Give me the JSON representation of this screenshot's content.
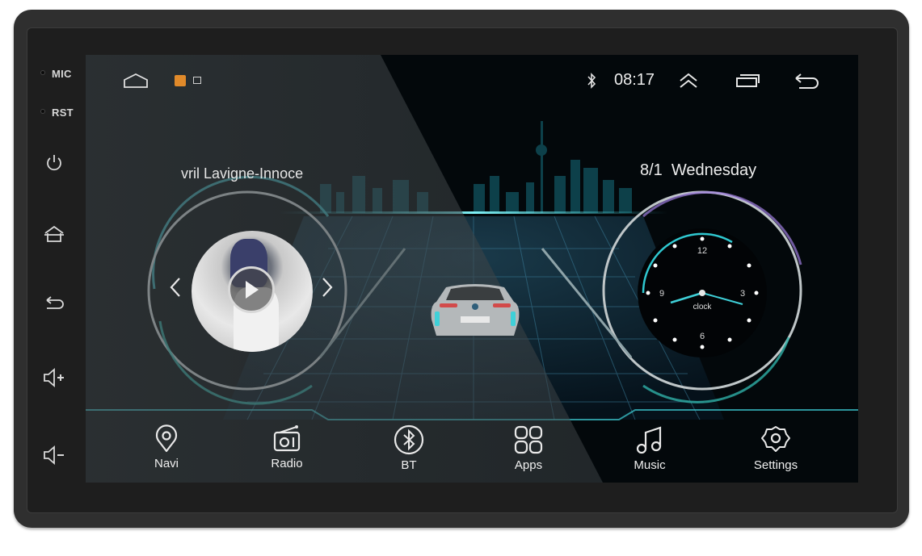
{
  "device": {
    "side_labels": {
      "mic": "MIC",
      "rst": "RST"
    },
    "side_buttons": [
      {
        "name": "power",
        "icon": "power-icon"
      },
      {
        "name": "home",
        "icon": "home-icon"
      },
      {
        "name": "back",
        "icon": "back-icon"
      },
      {
        "name": "volume-up",
        "icon": "volume-up-icon"
      },
      {
        "name": "volume-down",
        "icon": "volume-down-icon"
      }
    ]
  },
  "statusbar": {
    "left_icons": [
      "home-outline-icon",
      "notification-app-icon",
      "notification-image-icon"
    ],
    "bluetooth_icon": "bluetooth-icon",
    "time": "08:17",
    "right_icons": [
      "collapse-up-icon",
      "recent-apps-icon",
      "back-arrow-icon"
    ]
  },
  "media": {
    "song_title": "vril Lavigne-Innoce",
    "prev_icon": "chevron-left-icon",
    "next_icon": "chevron-right-icon",
    "play_icon": "play-icon"
  },
  "clock_widget": {
    "date": "8/1  Wednesday",
    "label": "clock",
    "numerals": [
      "12",
      "3",
      "6",
      "9"
    ],
    "time_shown": "08:17"
  },
  "dock": {
    "items": [
      {
        "label": "Navi",
        "icon": "location-pin-icon"
      },
      {
        "label": "Radio",
        "icon": "radio-icon"
      },
      {
        "label": "BT",
        "icon": "bluetooth-circle-icon"
      },
      {
        "label": "Apps",
        "icon": "apps-grid-icon"
      },
      {
        "label": "Music",
        "icon": "music-note-icon"
      },
      {
        "label": "Settings",
        "icon": "settings-gear-icon"
      }
    ]
  },
  "colors": {
    "accent_cyan": "#3fd0d8",
    "bezel": "#2f2f2f",
    "screen_bg": "#04090c",
    "text": "#ededed"
  }
}
